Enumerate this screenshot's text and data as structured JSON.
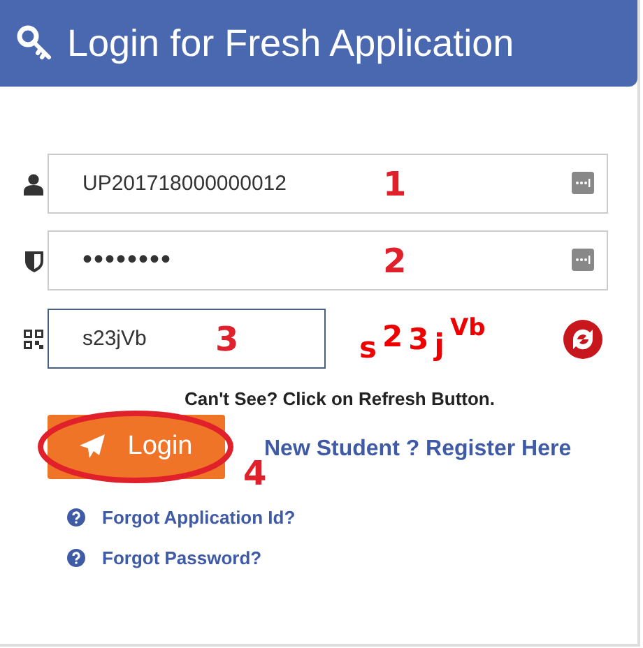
{
  "header": {
    "title": "Login for Fresh Application"
  },
  "fields": [
    {
      "kind": "text",
      "value": "UP201718000000012",
      "annotation": "1"
    },
    {
      "kind": "password",
      "value": "••••••••",
      "annotation": "2"
    }
  ],
  "captcha": {
    "value": "s23jVb",
    "annotation": "3",
    "code": "s23jVb"
  },
  "captcha_hint": "Can't See? Click on Refresh Button.",
  "login_button": {
    "label": "Login",
    "annotation": "4"
  },
  "register_link": "New Student ? Register Here",
  "help_links": [
    "Forgot Application Id?",
    "Forgot Password?"
  ]
}
